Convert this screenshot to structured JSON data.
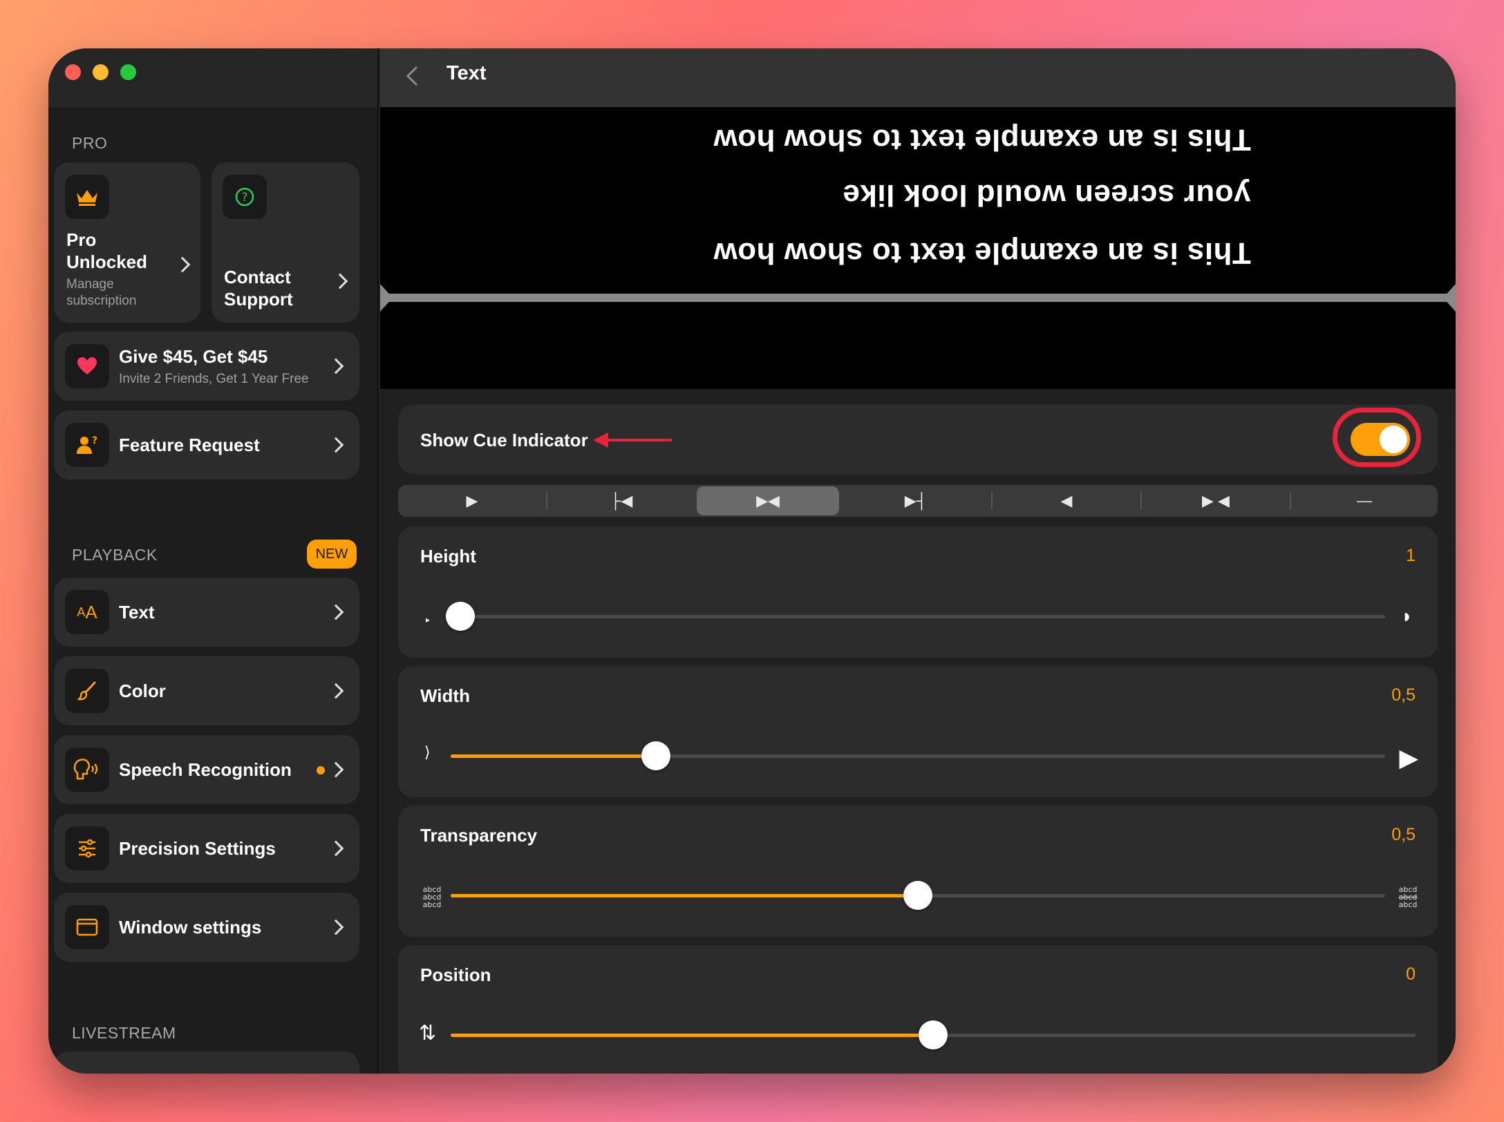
{
  "sidebar": {
    "pro_label": "PRO",
    "pro_card": {
      "title_line1": "Pro",
      "title_line2": "Unlocked",
      "sub_line1": "Manage",
      "sub_line2": "subscription"
    },
    "support_card": {
      "title_line1": "Contact",
      "title_line2": "Support"
    },
    "referral": {
      "title": "Give $45, Get $45",
      "subtitle": "Invite 2 Friends, Get 1 Year Free"
    },
    "feature_request": "Feature Request",
    "playback_label": "PLAYBACK",
    "new_badge": "NEW",
    "playback_items": [
      {
        "label": "Text",
        "icon": "text-size-icon"
      },
      {
        "label": "Color",
        "icon": "brush-icon"
      },
      {
        "label": "Speech Recognition",
        "icon": "speech-icon"
      },
      {
        "label": "Precision Settings",
        "icon": "sliders-icon"
      },
      {
        "label": "Window settings",
        "icon": "window-icon"
      }
    ],
    "livestream_label": "LIVESTREAM"
  },
  "main": {
    "title": "Text",
    "preview": {
      "line1": "This is an example text to show how",
      "line2": "your screen would look like",
      "line3": "This is an example text to show how"
    },
    "cue_indicator": {
      "label": "Show Cue Indicator",
      "enabled": true
    },
    "cue_styles": [
      "▶",
      "├◀",
      "▶◀",
      "▶┤",
      "◀",
      "▶ ◀",
      "—"
    ],
    "cue_styles_selected_index": 2,
    "height": {
      "label": "Height",
      "value": "1",
      "fraction": 0.0
    },
    "width": {
      "label": "Width",
      "value": "0,5",
      "fraction": 0.22
    },
    "transparency": {
      "label": "Transparency",
      "value": "0,5",
      "fraction": 0.5,
      "sample": "abcd"
    },
    "position": {
      "label": "Position",
      "value": "0",
      "fraction": 0.5
    }
  },
  "colors": {
    "accent": "#ff9f0a",
    "highlight": "#e8243c"
  }
}
